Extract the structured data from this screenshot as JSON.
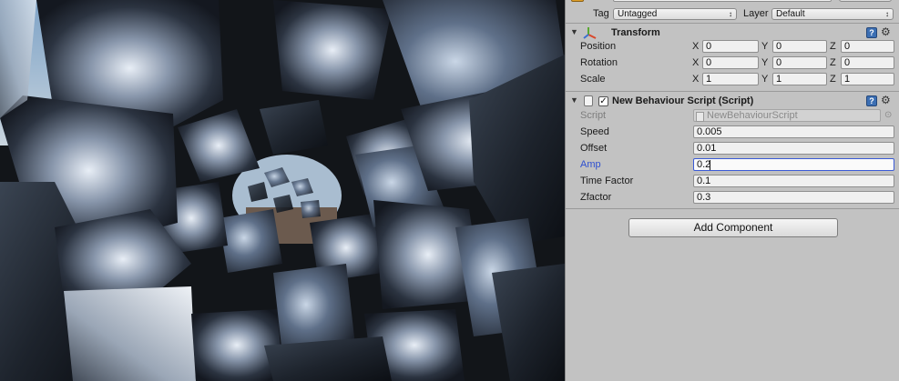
{
  "gameobject": {
    "tag_label": "Tag",
    "tag_value": "Untagged",
    "layer_label": "Layer",
    "layer_value": "Default"
  },
  "transform": {
    "title": "Transform",
    "position_label": "Position",
    "rotation_label": "Rotation",
    "scale_label": "Scale",
    "axis_x": "X",
    "axis_y": "Y",
    "axis_z": "Z",
    "position": {
      "x": "0",
      "y": "0",
      "z": "0"
    },
    "rotation": {
      "x": "0",
      "y": "0",
      "z": "0"
    },
    "scale": {
      "x": "1",
      "y": "1",
      "z": "1"
    }
  },
  "script_component": {
    "title": "New Behaviour Script (Script)",
    "enabled": true,
    "script_label": "Script",
    "script_value": "NewBehaviourScript",
    "fields": [
      {
        "label": "Speed",
        "value": "0.005"
      },
      {
        "label": "Offset",
        "value": "0.01"
      },
      {
        "label": "Amp",
        "value": "0.2"
      },
      {
        "label": "Time Factor",
        "value": "0.1"
      },
      {
        "label": "Zfactor",
        "value": "0.3"
      }
    ]
  },
  "add_component_label": "Add Component",
  "colors": {
    "inspector_bg": "#c2c2c2",
    "focus_accent": "#3b5bd6",
    "label_focus": "#2e4fd0",
    "transform_icon_red": "#d9482b",
    "transform_icon_green": "#5aa832",
    "transform_icon_blue": "#3b6fd1"
  }
}
